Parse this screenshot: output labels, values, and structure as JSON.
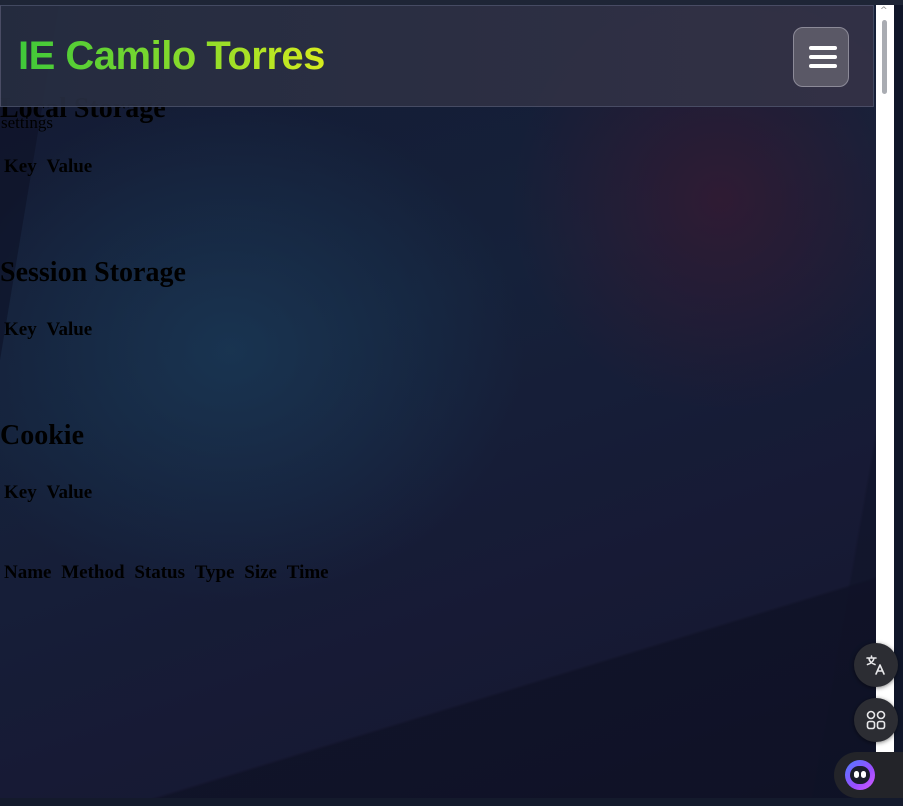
{
  "header": {
    "title": "IE Camilo Torres",
    "menu_icon": "hamburger-menu-icon"
  },
  "storage_panel": {
    "local_storage": {
      "title": "Local Storage",
      "entry_label": "settings",
      "columns": [
        "Key",
        "Value"
      ]
    },
    "session_storage": {
      "title": "Session Storage",
      "columns": [
        "Key",
        "Value"
      ]
    },
    "cookie": {
      "title": "Cookie",
      "columns": [
        "Key",
        "Value"
      ]
    },
    "network": {
      "columns": [
        "Name",
        "Method",
        "Status",
        "Type",
        "Size",
        "Time"
      ]
    }
  },
  "floating_tools": {
    "translate_icon": "translate-icon",
    "apps_icon": "apps-grid-icon",
    "assistant_icon": "assistant-bot-icon"
  },
  "colors": {
    "title_gradient_start": "#3fc93a",
    "title_gradient_end": "#d6ec1e",
    "header_background": "#2e3346",
    "menu_button_background": "#5a5866",
    "page_background": "#141a33"
  }
}
